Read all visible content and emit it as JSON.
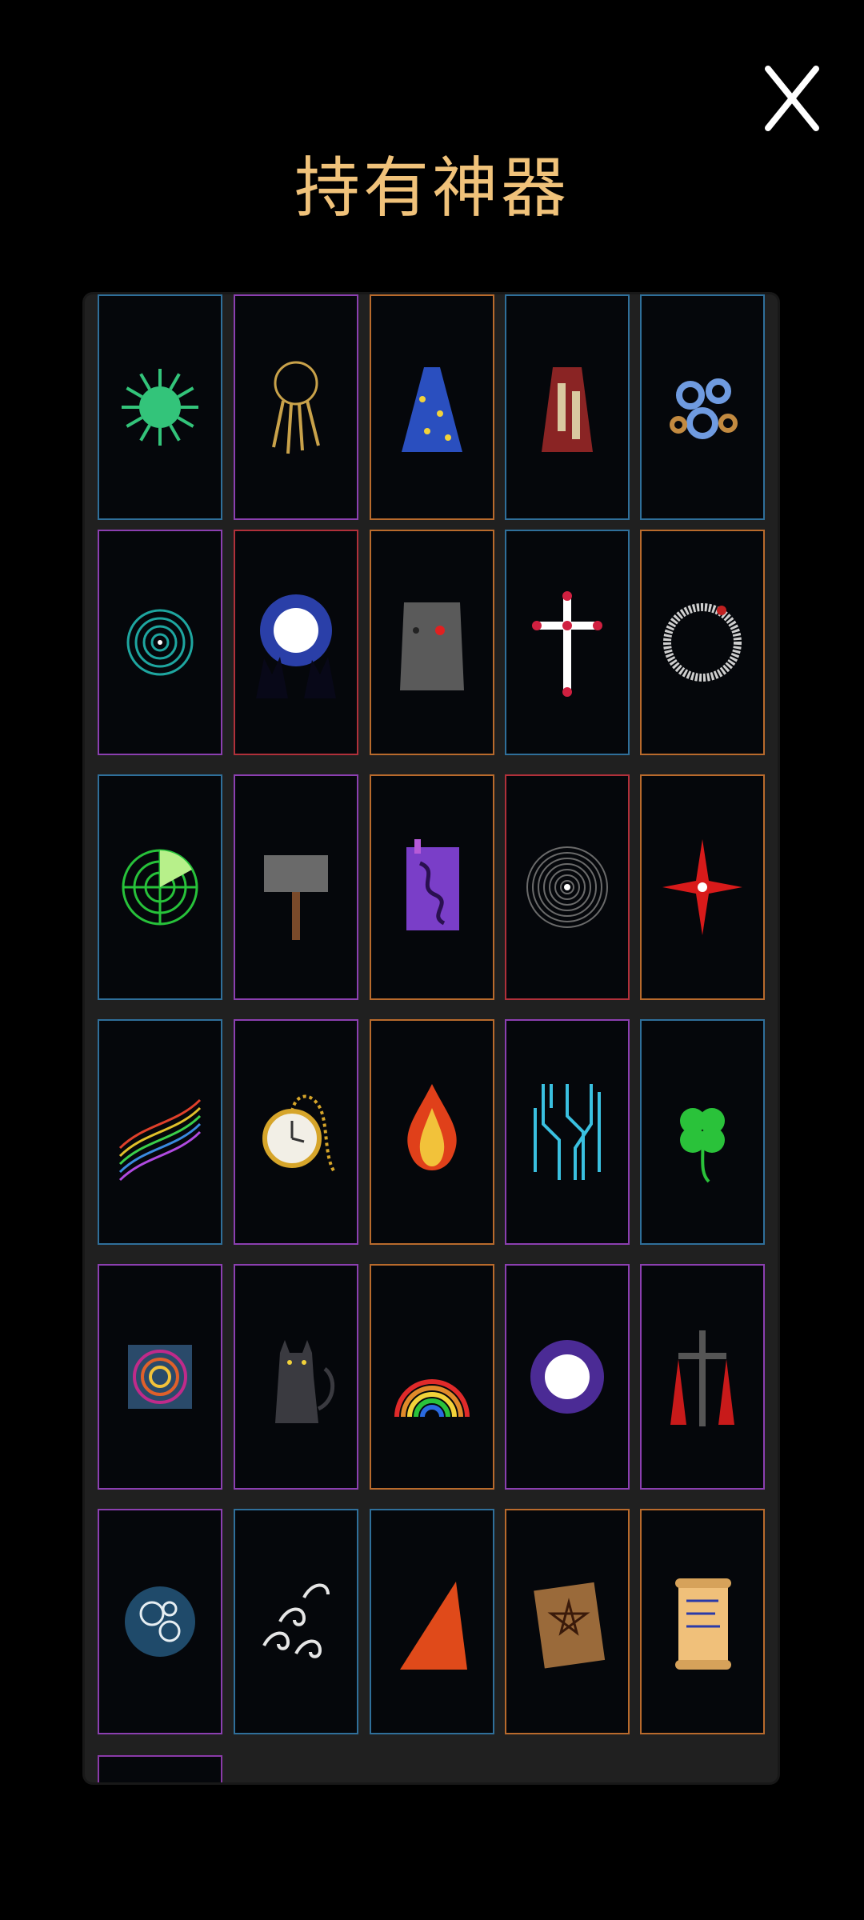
{
  "header": {
    "title": "持有神器"
  },
  "close_button": {
    "icon": "close-icon"
  },
  "artifacts": [
    {
      "icon": "virus-icon",
      "border": "#2f6f9a"
    },
    {
      "icon": "key-ring-icon",
      "border": "#8b3fb0"
    },
    {
      "icon": "wizard-cloak-icon",
      "border": "#b86a2c"
    },
    {
      "icon": "robe-icon",
      "border": "#2f6f9a"
    },
    {
      "icon": "gears-icon",
      "border": "#2f6f9a"
    },
    {
      "icon": "spiral-portal-icon",
      "border": "#8b3fb0"
    },
    {
      "icon": "moon-wolves-icon",
      "border": "#b0303a"
    },
    {
      "icon": "stone-face-icon",
      "border": "#b86a2c"
    },
    {
      "icon": "cross-icon",
      "border": "#2f6f9a"
    },
    {
      "icon": "ouroboros-icon",
      "border": "#b86a2c"
    },
    {
      "icon": "radar-icon",
      "border": "#2f6f9a"
    },
    {
      "icon": "hammer-icon",
      "border": "#8b3fb0"
    },
    {
      "icon": "spellbook-icon",
      "border": "#b86a2c"
    },
    {
      "icon": "void-ripple-icon",
      "border": "#b0303a"
    },
    {
      "icon": "red-star-icon",
      "border": "#b86a2c"
    },
    {
      "icon": "music-notes-icon",
      "border": "#2f6f9a"
    },
    {
      "icon": "pocket-watch-icon",
      "border": "#8b3fb0"
    },
    {
      "icon": "flame-icon",
      "border": "#b86a2c"
    },
    {
      "icon": "circuit-icon",
      "border": "#8b3fb0"
    },
    {
      "icon": "four-leaf-clover-icon",
      "border": "#2f6f9a"
    },
    {
      "icon": "hypno-square-icon",
      "border": "#8b3fb0"
    },
    {
      "icon": "black-cat-icon",
      "border": "#8b3fb0"
    },
    {
      "icon": "rainbow-icon",
      "border": "#b86a2c"
    },
    {
      "icon": "purple-orb-icon",
      "border": "#8b3fb0"
    },
    {
      "icon": "scarecrow-icon",
      "border": "#8b3fb0"
    },
    {
      "icon": "swirl-orb-icon",
      "border": "#8b3fb0"
    },
    {
      "icon": "wind-swirls-icon",
      "border": "#2f6f9a"
    },
    {
      "icon": "red-wedge-icon",
      "border": "#2f6f9a"
    },
    {
      "icon": "pentagram-book-icon",
      "border": "#b86a2c"
    },
    {
      "icon": "scroll-icon",
      "border": "#b86a2c"
    }
  ]
}
